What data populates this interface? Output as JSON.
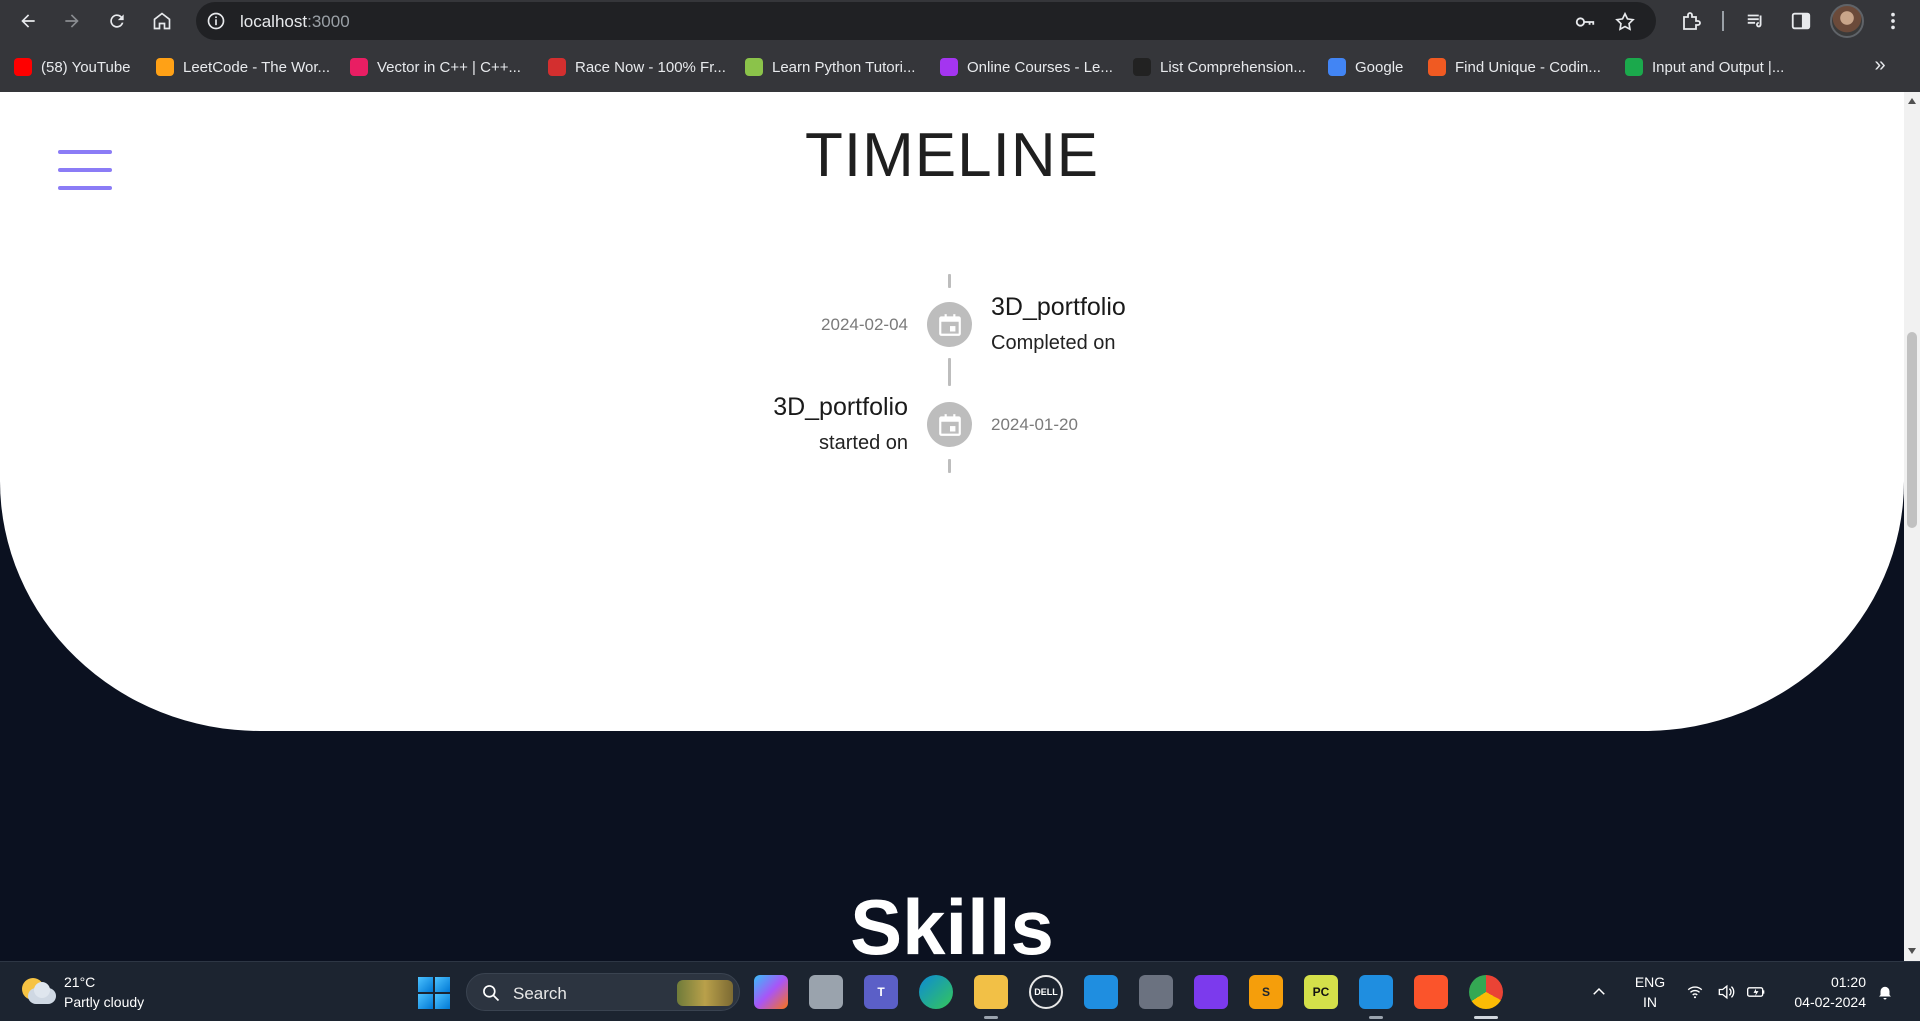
{
  "browser": {
    "url_host": "localhost",
    "url_port": ":3000",
    "bookmarks": [
      {
        "label": "(58) YouTube",
        "icon": "youtube-icon",
        "color": "#ff0000"
      },
      {
        "label": "LeetCode - The Wor...",
        "icon": "leetcode-icon",
        "color": "#ffa116"
      },
      {
        "label": "Vector in C++ | C++...",
        "icon": "vector-site-icon",
        "color": "#e91e63"
      },
      {
        "label": "Race Now - 100% Fr...",
        "icon": "race-now-icon",
        "color": "#d32f2f"
      },
      {
        "label": "Learn Python Tutori...",
        "icon": "python-tutorial-icon",
        "color": "#8bc34a"
      },
      {
        "label": "Online Courses - Le...",
        "icon": "udemy-icon",
        "color": "#a435f0"
      },
      {
        "label": "List Comprehension...",
        "icon": "list-comp-icon",
        "color": "#222222"
      },
      {
        "label": "Google",
        "icon": "google-icon",
        "color": "#4285f4"
      },
      {
        "label": "Find Unique - Codin...",
        "icon": "coding-ninjas-icon",
        "color": "#f05a22"
      },
      {
        "label": "Input and Output |...",
        "icon": "hackerrank-icon",
        "color": "#1ba94c"
      }
    ]
  },
  "page": {
    "timeline_title": "TIMELINE",
    "events": [
      {
        "date": "2024-02-04",
        "title": "3D_portfolio",
        "subtitle": "Completed on",
        "side": "right"
      },
      {
        "date": "2024-01-20",
        "title": "3D_portfolio",
        "subtitle": "started on",
        "side": "left"
      }
    ],
    "skills_title": "Skills",
    "accent_color": "#8b7cf6"
  },
  "taskbar": {
    "weather_temp": "21°C",
    "weather_desc": "Partly cloudy",
    "search_label": "Search",
    "lang_line1": "ENG",
    "lang_line2": "IN",
    "time": "01:20",
    "date": "04-02-2024"
  }
}
